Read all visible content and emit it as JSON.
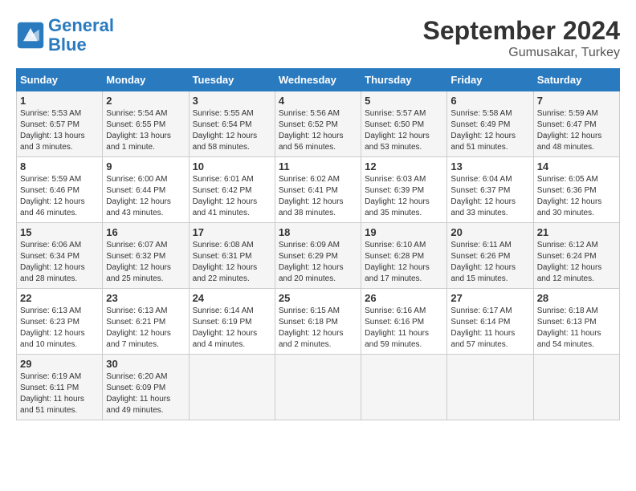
{
  "header": {
    "logo_line1": "General",
    "logo_line2": "Blue",
    "month_title": "September 2024",
    "location": "Gumusakar, Turkey"
  },
  "days_of_week": [
    "Sunday",
    "Monday",
    "Tuesday",
    "Wednesday",
    "Thursday",
    "Friday",
    "Saturday"
  ],
  "weeks": [
    [
      {
        "day": "1",
        "sunrise": "5:53 AM",
        "sunset": "6:57 PM",
        "daylight": "13 hours and 3 minutes."
      },
      {
        "day": "2",
        "sunrise": "5:54 AM",
        "sunset": "6:55 PM",
        "daylight": "13 hours and 1 minute."
      },
      {
        "day": "3",
        "sunrise": "5:55 AM",
        "sunset": "6:54 PM",
        "daylight": "12 hours and 58 minutes."
      },
      {
        "day": "4",
        "sunrise": "5:56 AM",
        "sunset": "6:52 PM",
        "daylight": "12 hours and 56 minutes."
      },
      {
        "day": "5",
        "sunrise": "5:57 AM",
        "sunset": "6:50 PM",
        "daylight": "12 hours and 53 minutes."
      },
      {
        "day": "6",
        "sunrise": "5:58 AM",
        "sunset": "6:49 PM",
        "daylight": "12 hours and 51 minutes."
      },
      {
        "day": "7",
        "sunrise": "5:59 AM",
        "sunset": "6:47 PM",
        "daylight": "12 hours and 48 minutes."
      }
    ],
    [
      {
        "day": "8",
        "sunrise": "5:59 AM",
        "sunset": "6:46 PM",
        "daylight": "12 hours and 46 minutes."
      },
      {
        "day": "9",
        "sunrise": "6:00 AM",
        "sunset": "6:44 PM",
        "daylight": "12 hours and 43 minutes."
      },
      {
        "day": "10",
        "sunrise": "6:01 AM",
        "sunset": "6:42 PM",
        "daylight": "12 hours and 41 minutes."
      },
      {
        "day": "11",
        "sunrise": "6:02 AM",
        "sunset": "6:41 PM",
        "daylight": "12 hours and 38 minutes."
      },
      {
        "day": "12",
        "sunrise": "6:03 AM",
        "sunset": "6:39 PM",
        "daylight": "12 hours and 35 minutes."
      },
      {
        "day": "13",
        "sunrise": "6:04 AM",
        "sunset": "6:37 PM",
        "daylight": "12 hours and 33 minutes."
      },
      {
        "day": "14",
        "sunrise": "6:05 AM",
        "sunset": "6:36 PM",
        "daylight": "12 hours and 30 minutes."
      }
    ],
    [
      {
        "day": "15",
        "sunrise": "6:06 AM",
        "sunset": "6:34 PM",
        "daylight": "12 hours and 28 minutes."
      },
      {
        "day": "16",
        "sunrise": "6:07 AM",
        "sunset": "6:32 PM",
        "daylight": "12 hours and 25 minutes."
      },
      {
        "day": "17",
        "sunrise": "6:08 AM",
        "sunset": "6:31 PM",
        "daylight": "12 hours and 22 minutes."
      },
      {
        "day": "18",
        "sunrise": "6:09 AM",
        "sunset": "6:29 PM",
        "daylight": "12 hours and 20 minutes."
      },
      {
        "day": "19",
        "sunrise": "6:10 AM",
        "sunset": "6:28 PM",
        "daylight": "12 hours and 17 minutes."
      },
      {
        "day": "20",
        "sunrise": "6:11 AM",
        "sunset": "6:26 PM",
        "daylight": "12 hours and 15 minutes."
      },
      {
        "day": "21",
        "sunrise": "6:12 AM",
        "sunset": "6:24 PM",
        "daylight": "12 hours and 12 minutes."
      }
    ],
    [
      {
        "day": "22",
        "sunrise": "6:13 AM",
        "sunset": "6:23 PM",
        "daylight": "12 hours and 10 minutes."
      },
      {
        "day": "23",
        "sunrise": "6:13 AM",
        "sunset": "6:21 PM",
        "daylight": "12 hours and 7 minutes."
      },
      {
        "day": "24",
        "sunrise": "6:14 AM",
        "sunset": "6:19 PM",
        "daylight": "12 hours and 4 minutes."
      },
      {
        "day": "25",
        "sunrise": "6:15 AM",
        "sunset": "6:18 PM",
        "daylight": "12 hours and 2 minutes."
      },
      {
        "day": "26",
        "sunrise": "6:16 AM",
        "sunset": "6:16 PM",
        "daylight": "11 hours and 59 minutes."
      },
      {
        "day": "27",
        "sunrise": "6:17 AM",
        "sunset": "6:14 PM",
        "daylight": "11 hours and 57 minutes."
      },
      {
        "day": "28",
        "sunrise": "6:18 AM",
        "sunset": "6:13 PM",
        "daylight": "11 hours and 54 minutes."
      }
    ],
    [
      {
        "day": "29",
        "sunrise": "6:19 AM",
        "sunset": "6:11 PM",
        "daylight": "11 hours and 51 minutes."
      },
      {
        "day": "30",
        "sunrise": "6:20 AM",
        "sunset": "6:09 PM",
        "daylight": "11 hours and 49 minutes."
      },
      null,
      null,
      null,
      null,
      null
    ]
  ]
}
